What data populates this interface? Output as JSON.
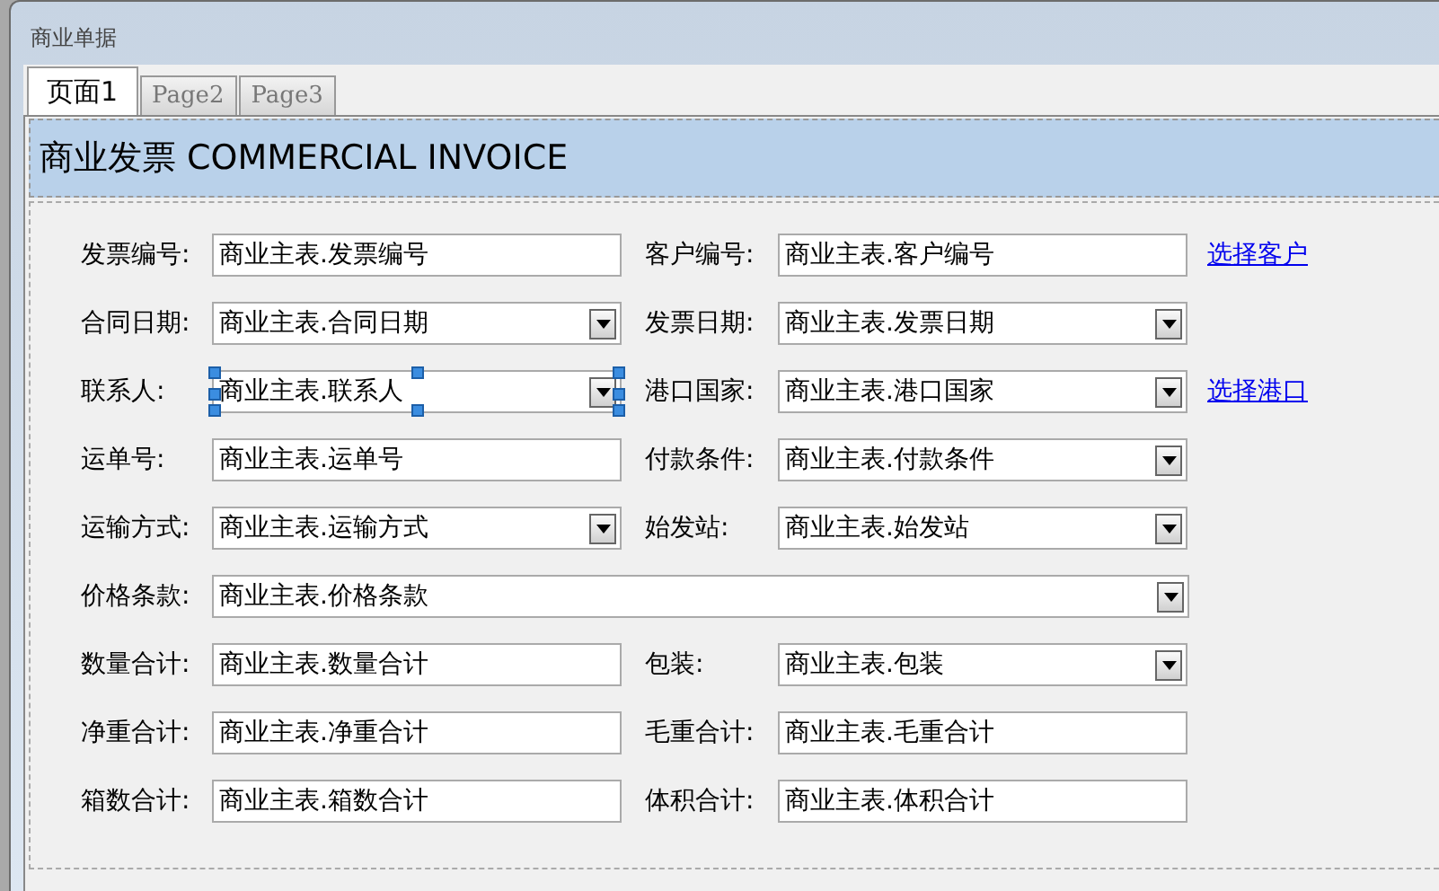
{
  "window": {
    "title": "商业单据"
  },
  "tabs": [
    {
      "label": "页面1",
      "selected": true
    },
    {
      "label": "Page2",
      "selected": false
    },
    {
      "label": "Page3",
      "selected": false
    }
  ],
  "header": {
    "title": "商业发票 COMMERCIAL INVOICE"
  },
  "rows": [
    {
      "fields": [
        {
          "label": "发票编号:",
          "value": "商业主表.发票编号",
          "kind": "text",
          "selected": false
        },
        {
          "label": "客户编号:",
          "value": "商业主表.客户编号",
          "kind": "text",
          "selected": false
        }
      ],
      "link": "选择客户"
    },
    {
      "fields": [
        {
          "label": "合同日期:",
          "value": "商业主表.合同日期",
          "kind": "combo",
          "selected": false
        },
        {
          "label": "发票日期:",
          "value": "商业主表.发票日期",
          "kind": "combo",
          "selected": false
        }
      ]
    },
    {
      "fields": [
        {
          "label": "联系人:",
          "value": "商业主表.联系人",
          "kind": "combo",
          "selected": true
        },
        {
          "label": "港口国家:",
          "value": "商业主表.港口国家",
          "kind": "combo",
          "selected": false
        }
      ],
      "link": "选择港口"
    },
    {
      "fields": [
        {
          "label": "运单号:",
          "value": "商业主表.运单号",
          "kind": "text",
          "selected": false
        },
        {
          "label": "付款条件:",
          "value": "商业主表.付款条件",
          "kind": "combo",
          "selected": false
        }
      ]
    },
    {
      "fields": [
        {
          "label": "运输方式:",
          "value": "商业主表.运输方式",
          "kind": "combo",
          "selected": false
        },
        {
          "label": "始发站:",
          "value": "商业主表.始发站",
          "kind": "combo",
          "selected": false
        }
      ]
    },
    {
      "fields": [
        {
          "label": "价格条款:",
          "value": "商业主表.价格条款",
          "kind": "combo",
          "selected": false
        }
      ]
    },
    {
      "fields": [
        {
          "label": "数量合计:",
          "value": "商业主表.数量合计",
          "kind": "text",
          "selected": false
        },
        {
          "label": "包装:",
          "value": "商业主表.包装",
          "kind": "combo",
          "selected": false
        }
      ]
    },
    {
      "fields": [
        {
          "label": "净重合计:",
          "value": "商业主表.净重合计",
          "kind": "text",
          "selected": false
        },
        {
          "label": "毛重合计:",
          "value": "商业主表.毛重合计",
          "kind": "text",
          "selected": false
        }
      ]
    },
    {
      "fields": [
        {
          "label": "箱数合计:",
          "value": "商业主表.箱数合计",
          "kind": "text",
          "selected": false
        },
        {
          "label": "体积合计:",
          "value": "商业主表.体积合计",
          "kind": "text",
          "selected": false
        }
      ]
    }
  ]
}
